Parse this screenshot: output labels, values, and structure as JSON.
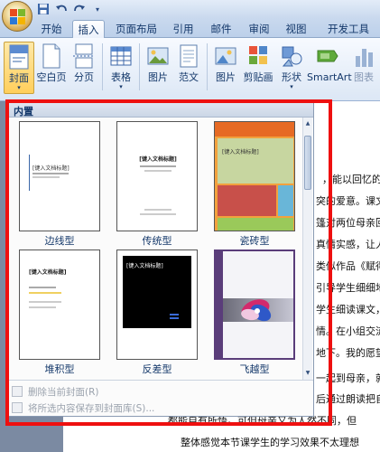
{
  "tabs": [
    "开始",
    "插入",
    "页面布局",
    "引用",
    "邮件",
    "审阅",
    "视图",
    "开发工具"
  ],
  "active_tab": "插入",
  "ribbon": {
    "cover": {
      "label": "封面",
      "arrow": "▾"
    },
    "blank": "空白页",
    "pagebreak": "分页",
    "table": {
      "label": "表格",
      "arrow": "▾"
    },
    "picture": "图片",
    "clipart": "范文",
    "picture2": "图片",
    "clipart2": "剪贴画",
    "shapes": {
      "label": "形状",
      "arrow": "▾"
    },
    "smartart": "SmartArt",
    "chart": "图表"
  },
  "gallery": {
    "header": "内置",
    "items": [
      {
        "label": "边线型",
        "title_text": "[键入文档标题]"
      },
      {
        "label": "传统型",
        "title_text": "[键入文档标题]"
      },
      {
        "label": "瓷砖型",
        "title_text": "[键入文档标题]"
      },
      {
        "label": "堆积型",
        "title_text": "[键入文档标题]"
      },
      {
        "label": "反差型",
        "title_text": "[键入文档标题]"
      },
      {
        "label": "飞越型",
        "title_text": ""
      }
    ],
    "footer": {
      "remove": "删除当前封面(R)",
      "save": "将所选内容保存到封面库(S)..."
    }
  },
  "document": {
    "lines": [
      "，能以回忆的形",
      "突的爱意。课文",
      "篷对两位母亲回",
      "真情实感，让人",
      "类似作品《赋得",
      "引导学生细细地",
      "学生细读课文，",
      "情。在小组交流",
      "地下。我的愿望",
      "一起到母亲，就",
      "后通过朗读把自",
      "都能自有所悟。可但母亲又为人然不同，但",
      "整体感觉本节课学生的学习效果不太理想"
    ]
  },
  "colors": {
    "highlight": "#ee1010",
    "ribbon_text": "#15396b"
  }
}
